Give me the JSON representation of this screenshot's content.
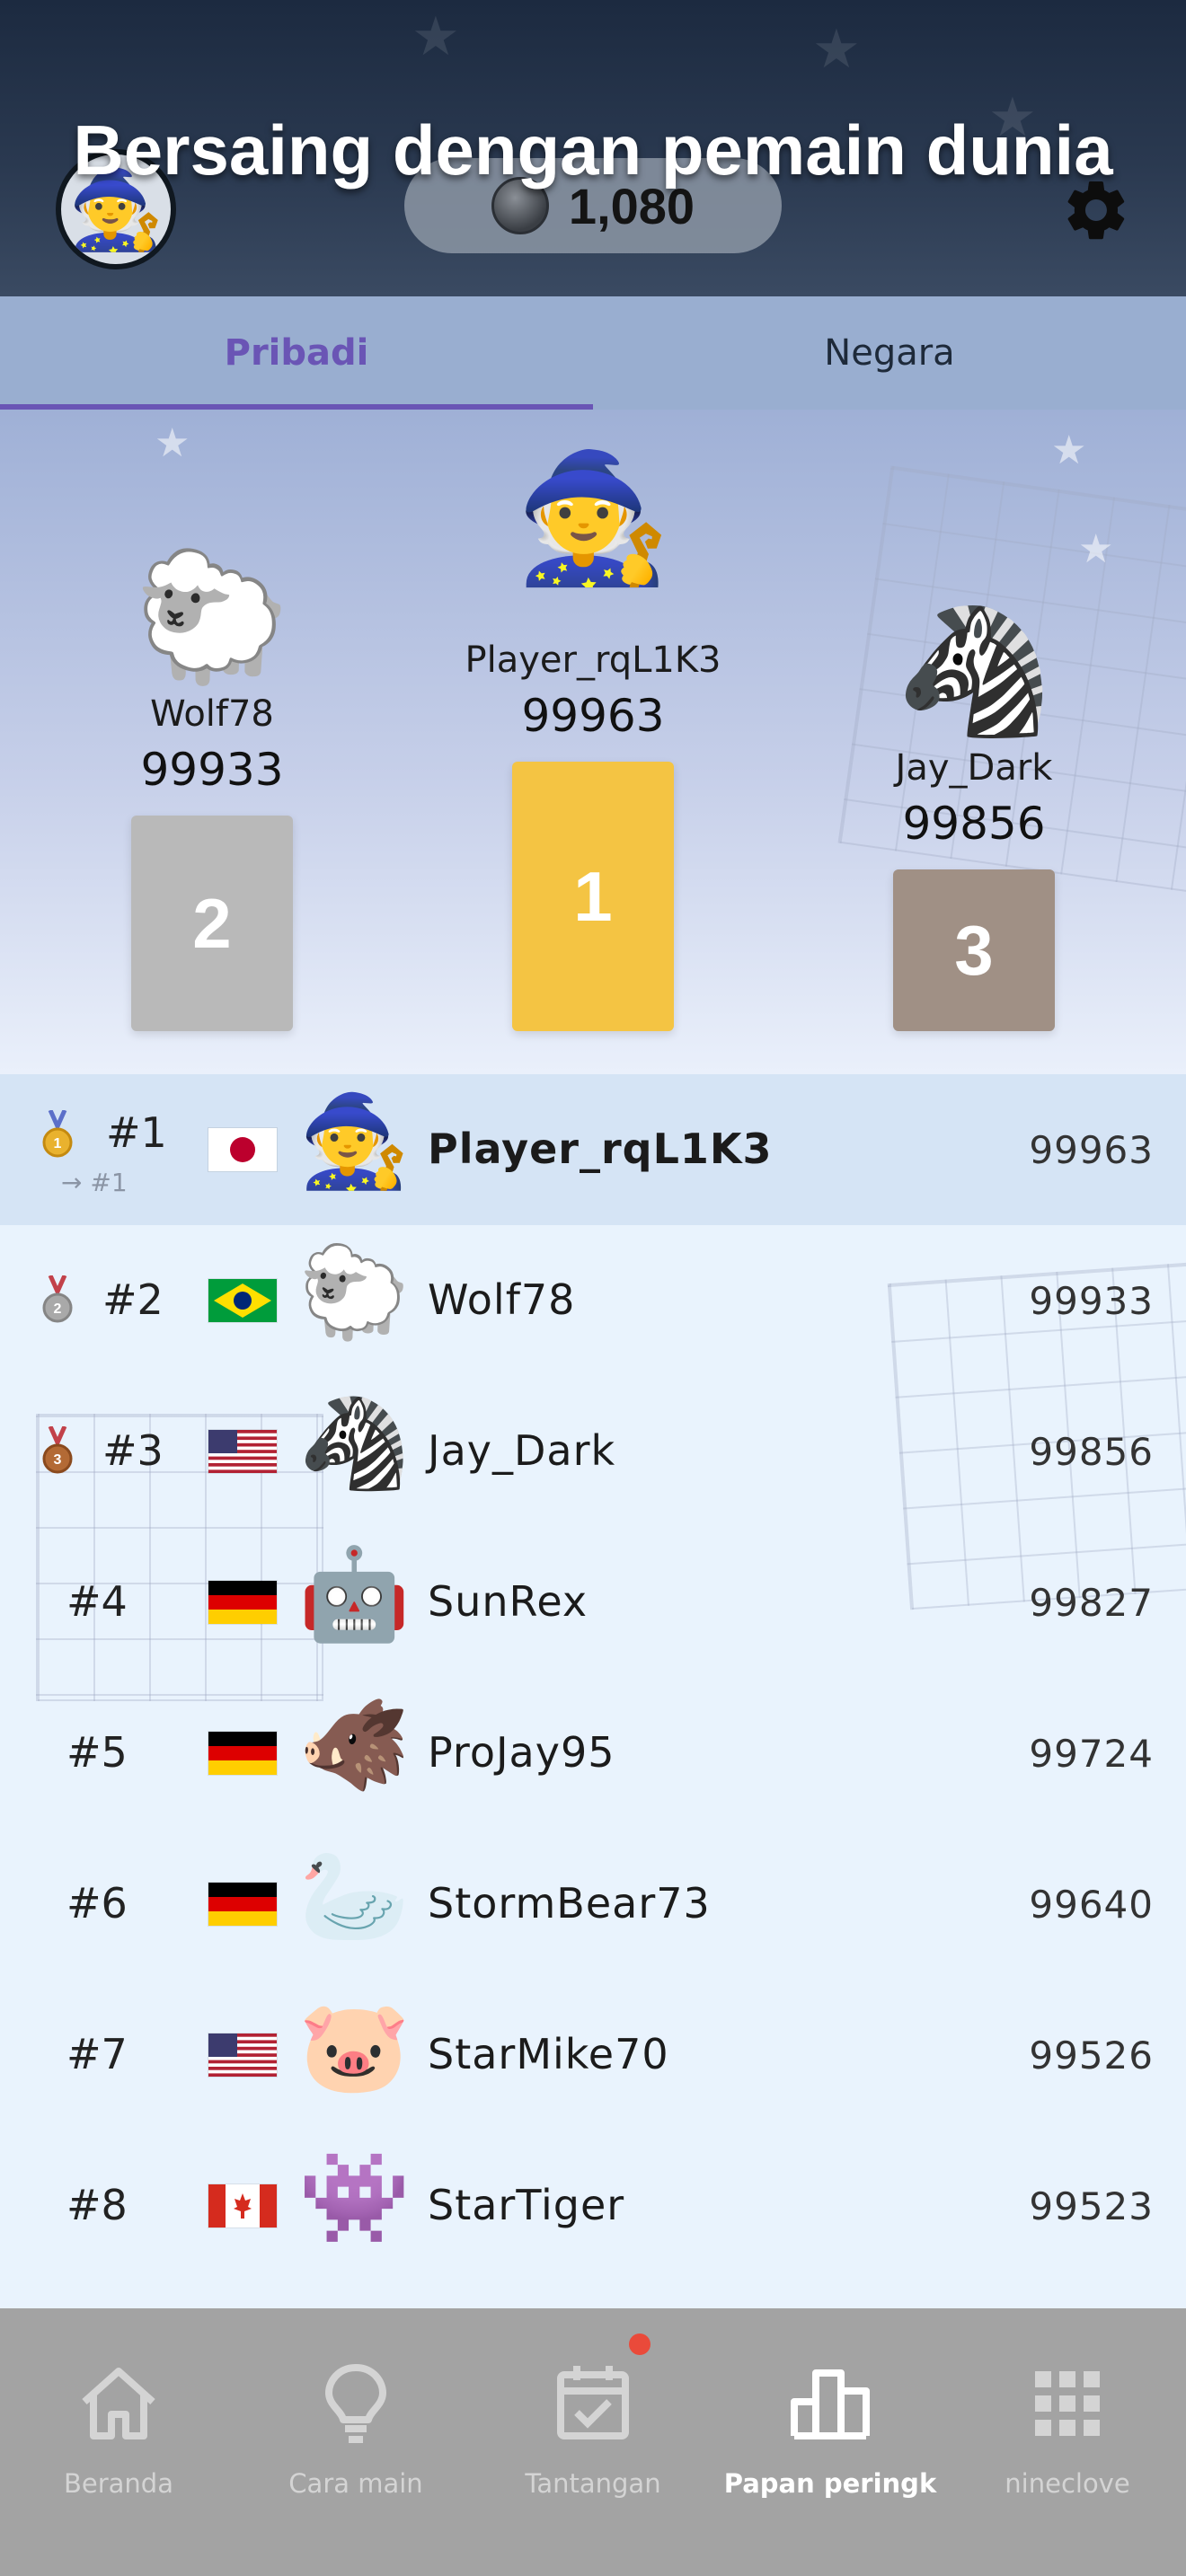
{
  "header": {
    "title": "Bersaing dengan pemain dunia",
    "coins": "1,080",
    "avatar_emoji": "🧙",
    "background_color": "#23324a"
  },
  "tabs": [
    {
      "label": "Pribadi",
      "active": true
    },
    {
      "label": "Negara",
      "active": false
    }
  ],
  "podium": [
    {
      "place": "1",
      "name": "Player_rqL1K3",
      "score": "99963",
      "emoji": "🧙",
      "color": "#f4c443"
    },
    {
      "place": "2",
      "name": "Wolf78",
      "score": "99933",
      "emoji": "🐑",
      "color": "#b9b9b9"
    },
    {
      "place": "3",
      "name": "Jay_Dark",
      "score": "99856",
      "emoji": "🦓",
      "color": "#a09085"
    }
  ],
  "leaderboard": [
    {
      "rank": "#1",
      "sub_rank": "→ #1",
      "flag": "jp",
      "emoji": "🧙",
      "name": "Player_rqL1K3",
      "score": "99963",
      "medal": "gold",
      "highlight": true
    },
    {
      "rank": "#2",
      "flag": "br",
      "emoji": "🐑",
      "name": "Wolf78",
      "score": "99933",
      "medal": "silver"
    },
    {
      "rank": "#3",
      "flag": "us",
      "emoji": "🦓",
      "name": "Jay_Dark",
      "score": "99856",
      "medal": "bronze"
    },
    {
      "rank": "#4",
      "flag": "de",
      "emoji": "🤖",
      "name": "SunRex",
      "score": "99827"
    },
    {
      "rank": "#5",
      "flag": "de",
      "emoji": "🐗",
      "name": "ProJay95",
      "score": "99724"
    },
    {
      "rank": "#6",
      "flag": "de",
      "emoji": "🦢",
      "name": "StormBear73",
      "score": "99640"
    },
    {
      "rank": "#7",
      "flag": "us",
      "emoji": "🐷",
      "name": "StarMike70",
      "score": "99526"
    },
    {
      "rank": "#8",
      "flag": "ca",
      "emoji": "👾",
      "name": "StarTiger",
      "score": "99523"
    }
  ],
  "nav": [
    {
      "label": "Beranda",
      "icon": "home-icon",
      "active": false
    },
    {
      "label": "Cara main",
      "icon": "lightbulb-icon",
      "active": false
    },
    {
      "label": "Tantangan",
      "icon": "calendar-check-icon",
      "active": false,
      "badge": true
    },
    {
      "label": "Papan peringk",
      "icon": "leaderboard-icon",
      "active": true
    },
    {
      "label": "nineclove",
      "icon": "grid-icon",
      "active": false
    }
  ],
  "colors": {
    "accent": "#6a55b5",
    "gold": "#f4c443",
    "silver": "#b9b9b9",
    "bronze": "#a09085",
    "badge": "#ea4a3a"
  }
}
